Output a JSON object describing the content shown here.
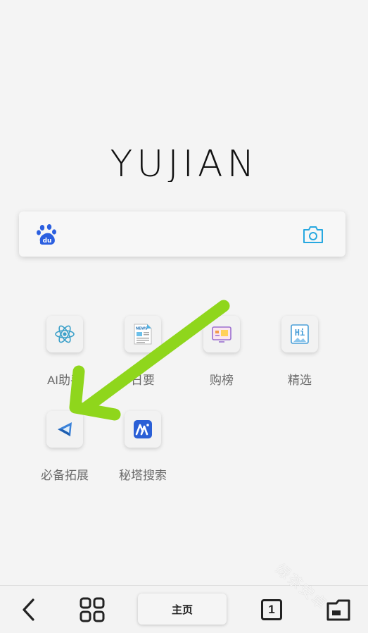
{
  "brand": {
    "logo_text": "YUJIAN"
  },
  "search": {
    "engine_icon": "baidu-paw-icon",
    "camera_icon": "camera-icon"
  },
  "shortcuts": [
    {
      "label": "AI助手",
      "icon": "react-atom-icon"
    },
    {
      "label": "日要",
      "icon": "news-icon"
    },
    {
      "label": "购榜",
      "icon": "shopping-icon"
    },
    {
      "label": "精选",
      "icon": "hi-icon"
    },
    {
      "label": "必备拓展",
      "icon": "extension-icon"
    },
    {
      "label": "秘塔搜索",
      "icon": "metaso-icon"
    }
  ],
  "annotation": {
    "arrow_color": "#8fd61c"
  },
  "bottombar": {
    "home_label": "主页",
    "tab_count": "1"
  },
  "watermark": {
    "text": "绿茶安卓"
  }
}
